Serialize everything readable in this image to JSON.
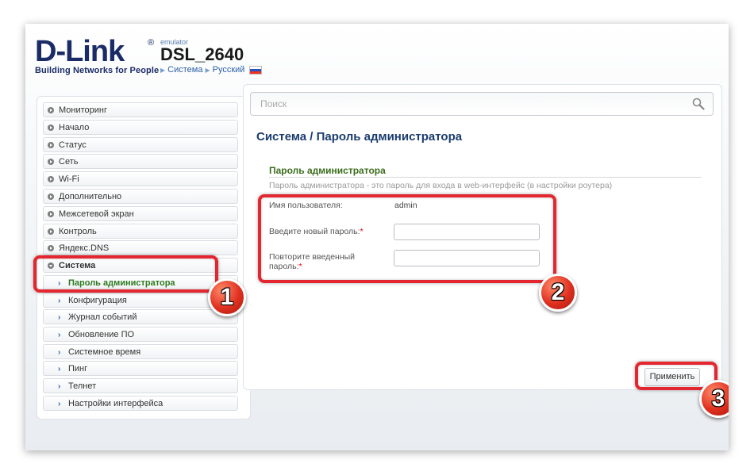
{
  "header": {
    "brand": "D-Link",
    "registered_mark": "®",
    "tagline": "Building Networks for People",
    "emulator_label": "emulator",
    "model": "DSL_2640",
    "crumb_system": "Система",
    "crumb_language": "Русский",
    "language_flag": "russia-flag"
  },
  "sidebar": {
    "items": [
      {
        "label": "Мониторинг"
      },
      {
        "label": "Начало"
      },
      {
        "label": "Статус"
      },
      {
        "label": "Сеть"
      },
      {
        "label": "Wi-Fi"
      },
      {
        "label": "Дополнительно"
      },
      {
        "label": "Межсетевой экран"
      },
      {
        "label": "Контроль"
      },
      {
        "label": "Яндекс.DNS"
      },
      {
        "label": "Система"
      }
    ],
    "subitems": [
      {
        "label": "Пароль администратора"
      },
      {
        "label": "Конфигурация"
      },
      {
        "label": "Журнал событий"
      },
      {
        "label": "Обновление ПО"
      },
      {
        "label": "Системное время"
      },
      {
        "label": "Пинг"
      },
      {
        "label": "Телнет"
      },
      {
        "label": "Настройки интерфейса"
      }
    ]
  },
  "search": {
    "placeholder": "Поиск"
  },
  "main": {
    "breadcrumb": "Система /  Пароль администратора",
    "section_title": "Пароль администратора",
    "section_desc": "Пароль администратора - это пароль для входа в web-интерфейс (в настройки роутера)",
    "username_label": "Имя пользователя:",
    "username_value": "admin",
    "new_password_label": "Введите новый пароль:",
    "repeat_password_label_1": "Повторите введенный",
    "repeat_password_label_2": "пароль:",
    "required_mark": "*",
    "apply_label": "Применить"
  },
  "annotations": {
    "badge_1": "1",
    "badge_2": "2",
    "badge_3": "3",
    "highlight_color": "#e3262f"
  },
  "colors": {
    "brand_navy": "#1a2b66",
    "link_blue": "#2a5fa5",
    "section_green": "#3b6d1b",
    "active_green": "#2d7a1e"
  }
}
